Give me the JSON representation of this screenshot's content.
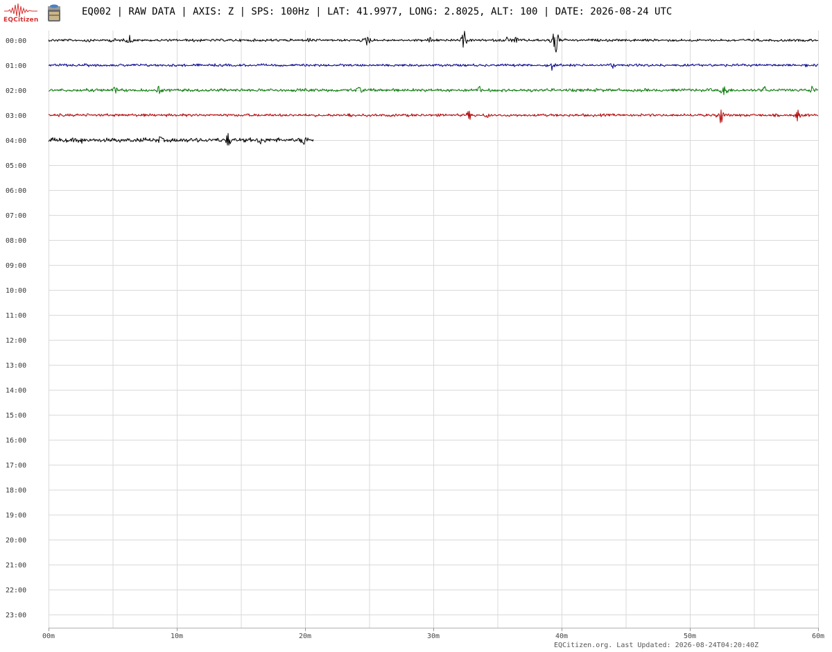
{
  "header": {
    "title": "EQ002 | RAW DATA | AXIS: Z | SPS: 100Hz | LAT: 41.9977, LONG: 2.8025, ALT: 100 | DATE: 2026-08-24 UTC",
    "logo_text": "EQCitizen"
  },
  "footer": {
    "updated": "EQCitizen.org. Last Updated: 2026-08-24T04:20:40Z"
  },
  "colors": {
    "black": "#000000",
    "blue": "#00008b",
    "green": "#007a00",
    "red": "#b00000",
    "grid": "#d9d9d9",
    "logo": "#d83030"
  },
  "chart_data": {
    "type": "line",
    "title": "EQ002 | RAW DATA | AXIS: Z | SPS: 100Hz | LAT: 41.9977, LONG: 2.8025, ALT: 100 | DATE: 2026-08-24 UTC",
    "row_labels": [
      "00:00",
      "01:00",
      "02:00",
      "03:00",
      "04:00",
      "05:00",
      "06:00",
      "07:00",
      "08:00",
      "09:00",
      "10:00",
      "11:00",
      "12:00",
      "13:00",
      "14:00",
      "15:00",
      "16:00",
      "17:00",
      "18:00",
      "19:00",
      "20:00",
      "21:00",
      "22:00",
      "23:00"
    ],
    "x_ticks": [
      {
        "value": 0,
        "label": "00m"
      },
      {
        "value": 10,
        "label": "10m"
      },
      {
        "value": 20,
        "label": "20m"
      },
      {
        "value": 30,
        "label": "30m"
      },
      {
        "value": 40,
        "label": "40m"
      },
      {
        "value": 50,
        "label": "50m"
      },
      {
        "value": 60,
        "label": "60m"
      }
    ],
    "xlim": [
      0,
      60
    ],
    "grid_minor_minutes": 5,
    "grid": true,
    "series": [
      {
        "hour": "00:00",
        "color": "#000000",
        "end_minute": 60,
        "noise": 1.5,
        "bursts": [
          {
            "minute": 3.0,
            "amp": 3
          },
          {
            "minute": 5.0,
            "amp": 5
          },
          {
            "minute": 6.3,
            "amp": 9
          },
          {
            "minute": 11.5,
            "amp": 4
          },
          {
            "minute": 20.3,
            "amp": 3
          },
          {
            "minute": 24.9,
            "amp": 14
          },
          {
            "minute": 29.8,
            "amp": 6
          },
          {
            "minute": 32.4,
            "amp": 18
          },
          {
            "minute": 35.8,
            "amp": 8
          },
          {
            "minute": 36.4,
            "amp": 6
          },
          {
            "minute": 39.4,
            "amp": 24
          },
          {
            "minute": 39.6,
            "amp": 20
          }
        ]
      },
      {
        "hour": "01:00",
        "color": "#00008b",
        "end_minute": 60,
        "noise": 1.5,
        "bursts": [
          {
            "minute": 39.3,
            "amp": 11
          },
          {
            "minute": 44.0,
            "amp": 4
          },
          {
            "minute": 59.0,
            "amp": 3
          }
        ]
      },
      {
        "hour": "02:00",
        "color": "#007a00",
        "end_minute": 60,
        "noise": 1.8,
        "bursts": [
          {
            "minute": 5.2,
            "amp": 5
          },
          {
            "minute": 8.6,
            "amp": 6
          },
          {
            "minute": 24.2,
            "amp": 6
          },
          {
            "minute": 33.6,
            "amp": 5
          },
          {
            "minute": 52.7,
            "amp": 20
          },
          {
            "minute": 55.8,
            "amp": 7
          },
          {
            "minute": 59.5,
            "amp": 8
          }
        ]
      },
      {
        "hour": "03:00",
        "color": "#b00000",
        "end_minute": 60,
        "noise": 1.6,
        "bursts": [
          {
            "minute": 23.5,
            "amp": 5
          },
          {
            "minute": 32.8,
            "amp": 8
          },
          {
            "minute": 34.2,
            "amp": 4
          },
          {
            "minute": 52.4,
            "amp": 20
          },
          {
            "minute": 58.4,
            "amp": 10
          }
        ]
      },
      {
        "hour": "04:00",
        "color": "#000000",
        "end_minute": 20.7,
        "noise": 2.5,
        "bursts": [
          {
            "minute": 2.5,
            "amp": 5
          },
          {
            "minute": 8.7,
            "amp": 5
          },
          {
            "minute": 14.0,
            "amp": 12
          },
          {
            "minute": 16.5,
            "amp": 6
          },
          {
            "minute": 19.9,
            "amp": 10
          }
        ]
      }
    ]
  }
}
